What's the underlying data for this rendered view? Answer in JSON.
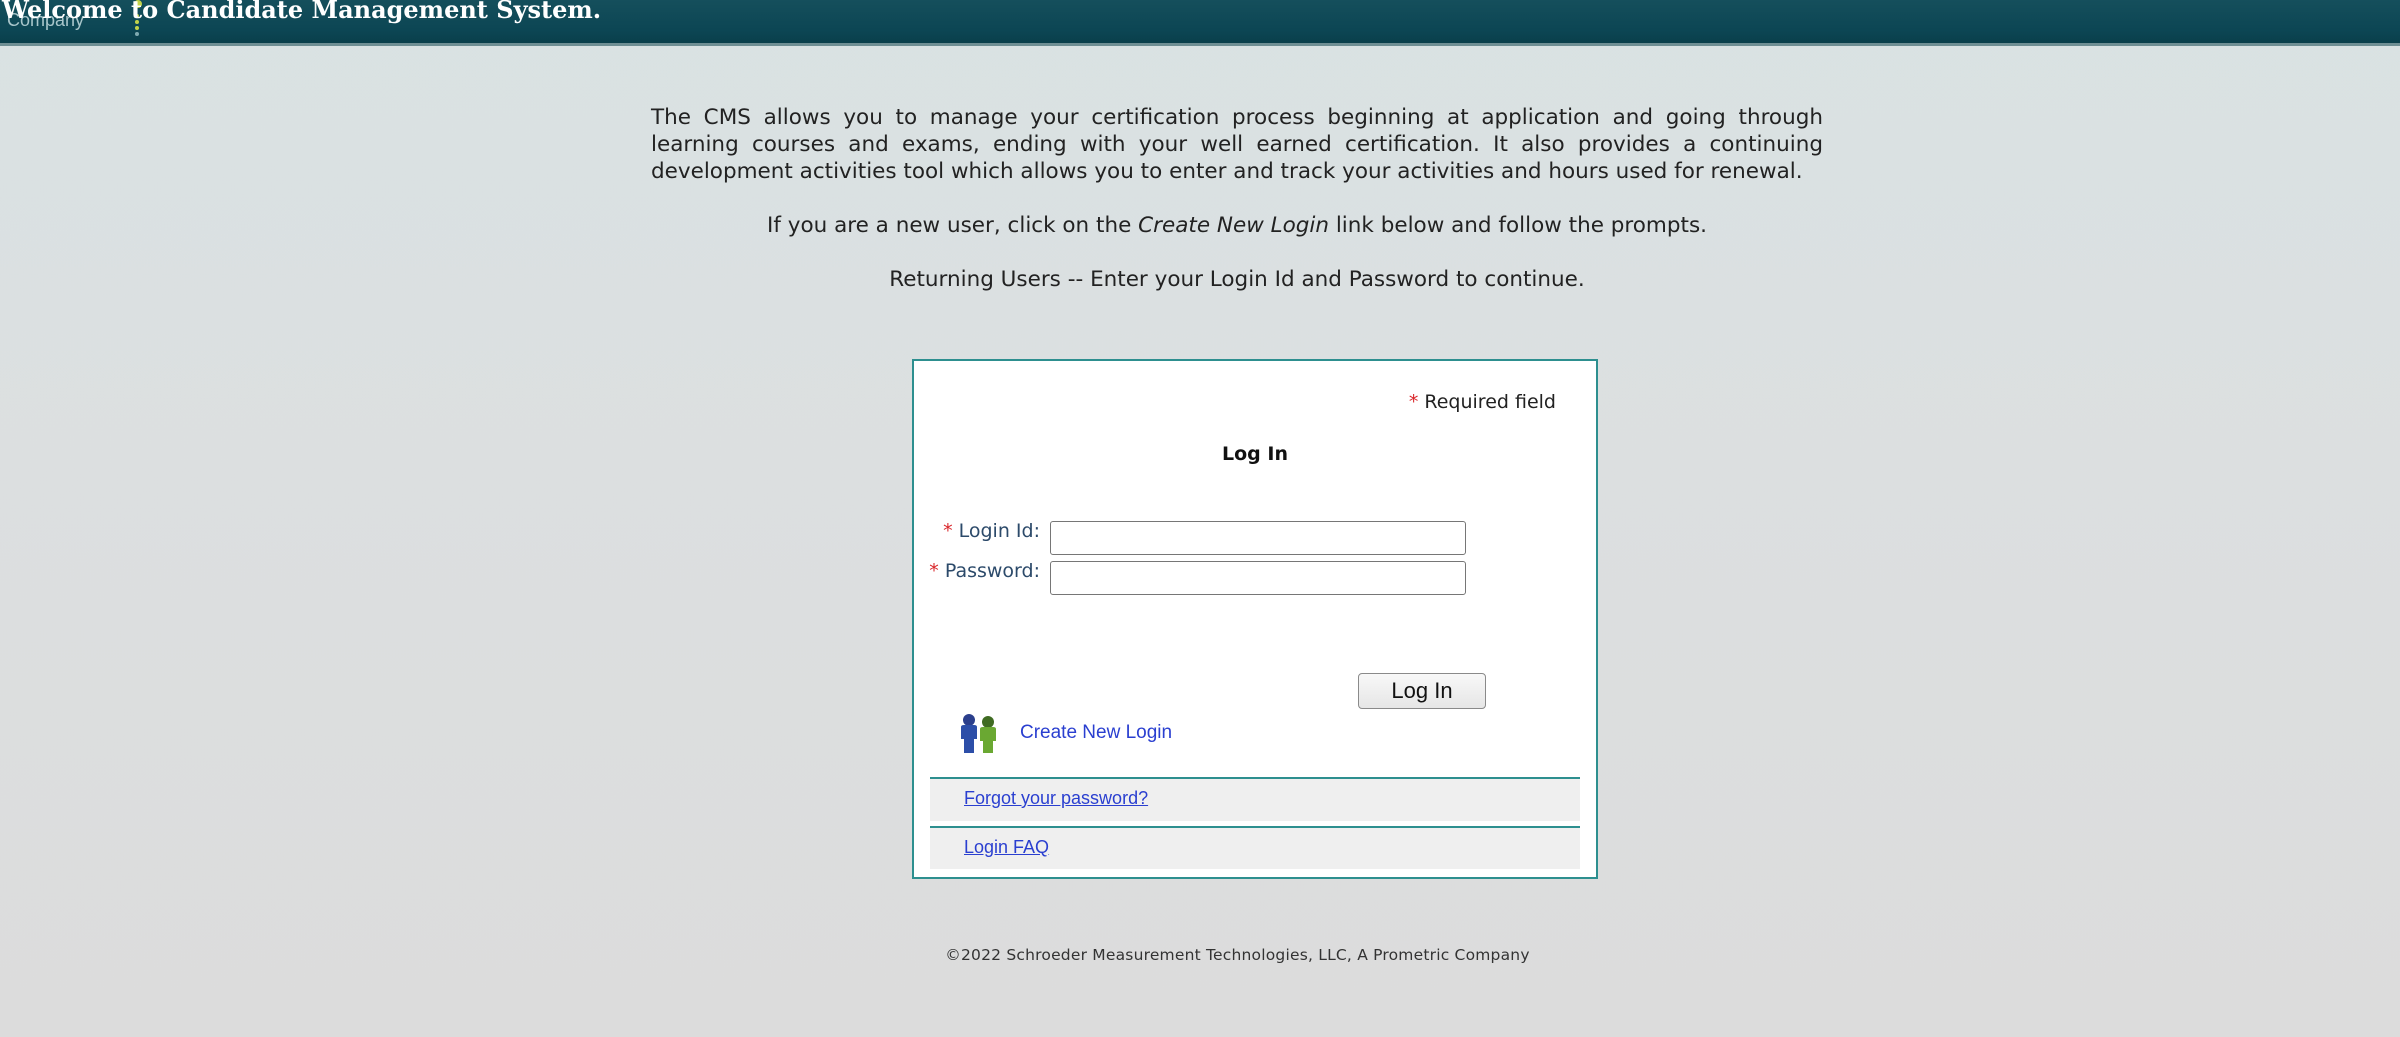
{
  "header": {
    "title": "Welcome to Candidate Management System.",
    "company": "Company"
  },
  "intro": {
    "paragraph1": "The CMS allows you to manage your certification process beginning at application and going through learning courses and exams, ending with your well earned certification. It also provides a continuing development activities tool which allows you to enter and track your activities and hours used for renewal.",
    "paragraph2_before": "If you are a new user, click on the ",
    "paragraph2_link": "Create New Login",
    "paragraph2_after": " link below and follow the prompts.",
    "paragraph3": "Returning Users -- Enter your Login Id and Password to continue."
  },
  "login": {
    "required_marker": "*",
    "required_text": "Required field",
    "title": "Log In",
    "login_id_label": "Login Id:",
    "login_id_value": "",
    "password_label": "Password:",
    "password_value": "",
    "submit_label": "Log In",
    "create_new_login": "Create New Login",
    "forgot_password": "Forgot your password?",
    "login_faq": "Login FAQ"
  },
  "footer": {
    "copyright": "©2022 Schroeder Measurement Technologies, LLC, A Prometric Company"
  },
  "colors": {
    "header_bg": "#0c4654",
    "box_border": "#2d8f8f",
    "link": "#2a3fd0",
    "required_star": "#d9262a"
  },
  "icons": {
    "create_login": "people-icon"
  }
}
